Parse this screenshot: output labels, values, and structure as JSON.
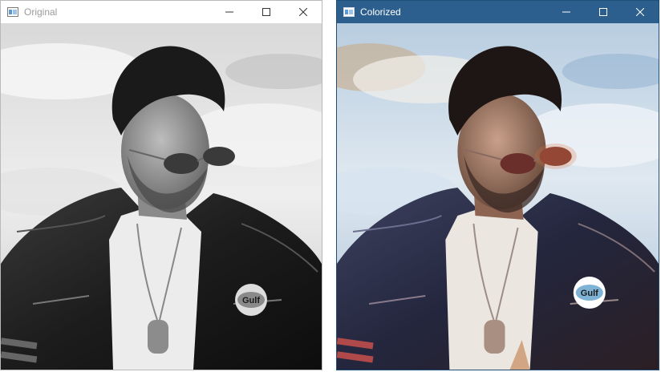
{
  "windows": {
    "original": {
      "title": "Original",
      "icon": "app-window-icon",
      "controls": [
        "minimize-icon",
        "maximize-icon",
        "close-icon"
      ]
    },
    "colorized": {
      "title": "Colorized",
      "icon": "app-window-icon",
      "controls": [
        "minimize-icon",
        "maximize-icon",
        "close-icon"
      ]
    }
  },
  "image": {
    "badge_text": "Gulf"
  },
  "colors": {
    "active_titlebar": "#2c5f8e",
    "inactive_titlebar": "#ffffff",
    "badge_orange": "#e87722",
    "badge_blue": "#7fb3d5"
  }
}
